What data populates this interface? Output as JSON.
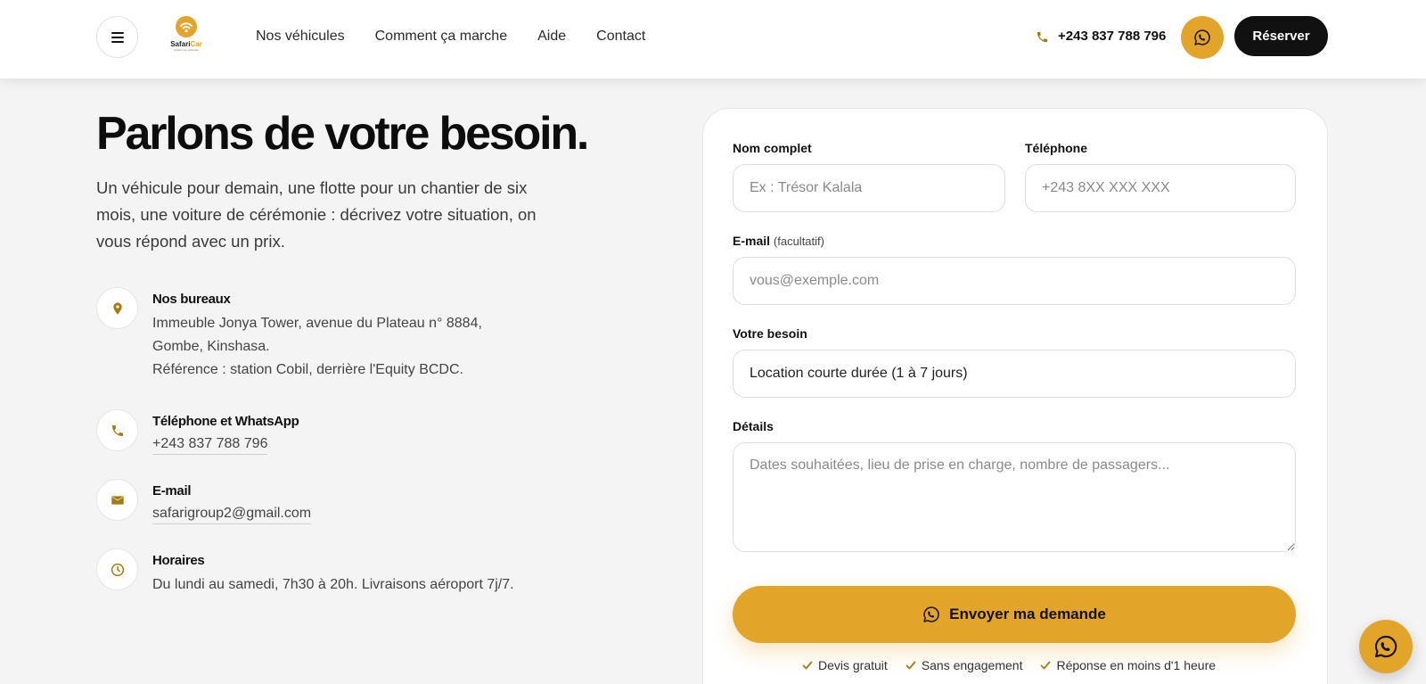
{
  "header": {
    "logo": {
      "name_part1": "Safari",
      "name_part2": "Car",
      "tagline": "location de véhicules"
    },
    "nav": [
      "Nos véhicules",
      "Comment ça marche",
      "Aide",
      "Contact"
    ],
    "phone": "+243 837 788 796",
    "reserve_label": "Réserver"
  },
  "hero": {
    "title": "Parlons de votre besoin.",
    "intro": "Un véhicule pour demain, une flotte pour un chantier de six mois, une voiture de cérémonie : décrivez votre situation, on vous répond avec un prix."
  },
  "contact_info": {
    "office": {
      "title": "Nos bureaux",
      "line1": "Immeuble Jonya Tower, avenue du Plateau n° 8884,",
      "line2": "Gombe, Kinshasa.",
      "line3": "Référence : station Cobil, derrière l'Equity BCDC."
    },
    "phone": {
      "title": "Téléphone et WhatsApp",
      "value": "+243 837 788 796"
    },
    "email": {
      "title": "E-mail",
      "value": "safarigroup2@gmail.com"
    },
    "hours": {
      "title": "Horaires",
      "value": "Du lundi au samedi, 7h30 à 20h. Livraisons aéroport 7j/7."
    }
  },
  "form": {
    "name_label": "Nom complet",
    "name_placeholder": "Ex : Trésor Kalala",
    "phone_label": "Téléphone",
    "phone_placeholder": "+243 8XX XXX XXX",
    "email_label": "E-mail",
    "email_optional": "(facultatif)",
    "email_placeholder": "vous@exemple.com",
    "need_label": "Votre besoin",
    "need_value": "Location courte durée (1 à 7 jours)",
    "details_label": "Détails",
    "details_placeholder": "Dates souhaitées, lieu de prise en charge, nombre de passagers...",
    "submit_label": "Envoyer ma demande",
    "assurances": [
      "Devis gratuit",
      "Sans engagement",
      "Réponse en moins d'1 heure"
    ]
  },
  "colors": {
    "accent": "#e3a42a",
    "dark": "#111111",
    "icon_gold": "#a87a10"
  },
  "icons": {
    "menu": "menu-icon",
    "logo": "signal-icon",
    "phone": "phone-icon",
    "whatsapp": "whatsapp-icon",
    "office": "map-pin-icon",
    "email": "envelope-icon",
    "hours": "clock-icon",
    "check": "check-icon"
  }
}
